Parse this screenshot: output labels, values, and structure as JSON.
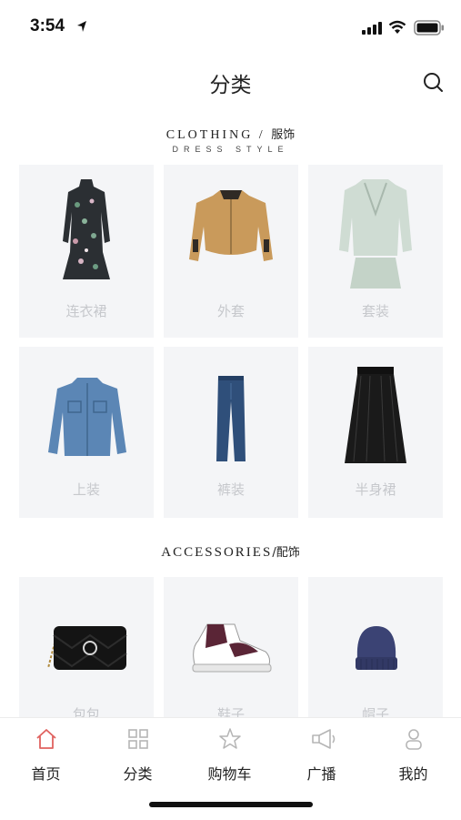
{
  "status_bar": {
    "time": "3:54"
  },
  "header": {
    "title": "分类"
  },
  "clothing_section": {
    "title_en": "CLOTHING /",
    "title_cn": "服饰",
    "subtitle": "DRESS STYLE",
    "items": [
      {
        "label": "连衣裙",
        "icon": "floral-dress-icon"
      },
      {
        "label": "外套",
        "icon": "jacket-icon"
      },
      {
        "label": "套装",
        "icon": "suit-set-icon"
      },
      {
        "label": "上装",
        "icon": "denim-jacket-icon"
      },
      {
        "label": "裤装",
        "icon": "jeans-icon"
      },
      {
        "label": "半身裙",
        "icon": "tulle-skirt-icon"
      }
    ]
  },
  "accessories_section": {
    "title_en": "ACCESSORIES",
    "title_cn": "/配饰",
    "items": [
      {
        "label": "包包",
        "icon": "handbag-icon"
      },
      {
        "label": "鞋子",
        "icon": "sneaker-icon"
      },
      {
        "label": "帽子",
        "icon": "beanie-icon"
      }
    ]
  },
  "tabbar": {
    "tabs": [
      {
        "label": "首页",
        "icon": "home-icon"
      },
      {
        "label": "分类",
        "icon": "grid-icon"
      },
      {
        "label": "购物车",
        "icon": "star-icon"
      },
      {
        "label": "广播",
        "icon": "megaphone-icon"
      },
      {
        "label": "我的",
        "icon": "user-icon"
      }
    ]
  },
  "colors": {
    "active_tab_icon": "#e0625f",
    "inactive_tab_icon": "#b5b5b5",
    "card_background": "#f4f5f7",
    "card_label": "#c6c8cc"
  }
}
